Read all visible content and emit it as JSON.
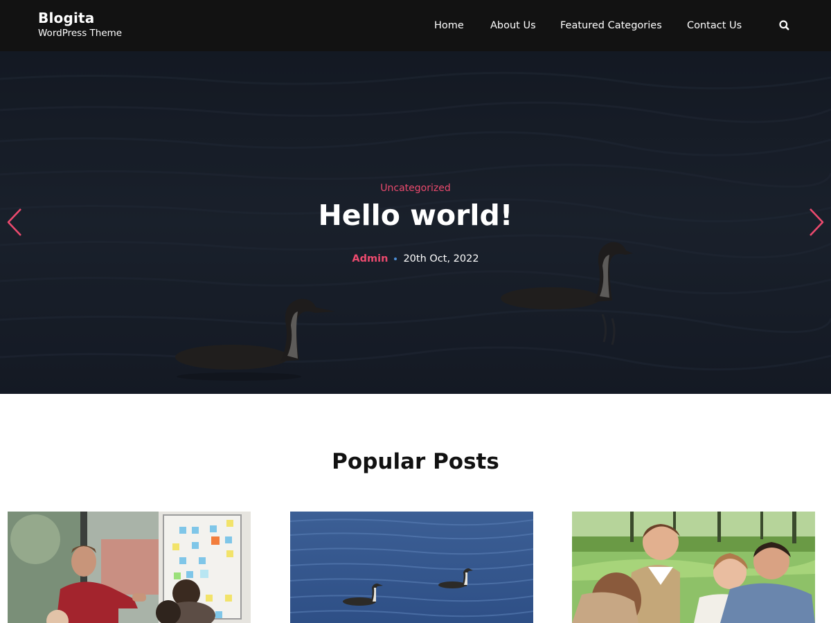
{
  "brand": {
    "title": "Blogita",
    "tagline": "WordPress Theme"
  },
  "nav": {
    "items": [
      {
        "label": "Home"
      },
      {
        "label": "About Us"
      },
      {
        "label": "Featured Categories"
      },
      {
        "label": "Contact Us"
      }
    ],
    "search_icon": "search-icon"
  },
  "hero": {
    "category": "Uncategorized",
    "title": "Hello world!",
    "author": "Admin",
    "date": "20th Oct, 2022",
    "prev_icon": "chevron-left-icon",
    "next_icon": "chevron-right-icon"
  },
  "popular": {
    "title": "Popular Posts",
    "cards": [
      {
        "image": "presentation-whiteboard-photo"
      },
      {
        "image": "ducks-on-water-photo"
      },
      {
        "image": "family-in-park-photo"
      }
    ]
  },
  "colors": {
    "accent": "#ec4a6e",
    "header_bg": "#121212",
    "dot": "#4c8fd8"
  }
}
